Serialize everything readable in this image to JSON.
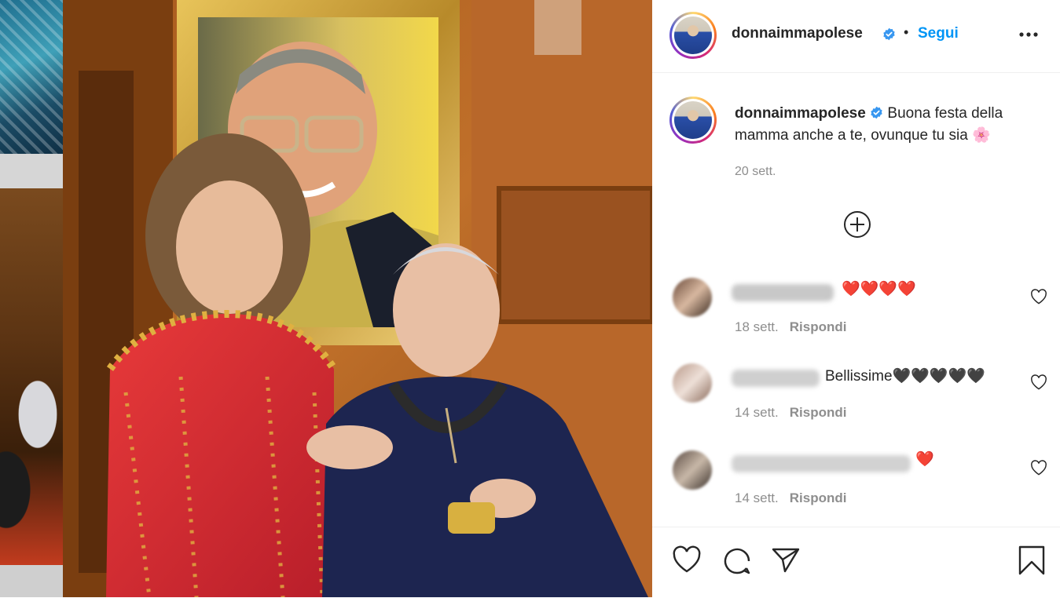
{
  "post": {
    "username": "donnaimmapolese",
    "follow_label": "Segui",
    "separator": "•",
    "caption_text": "Buona festa della mamma anche a te, ovunque tu sia",
    "caption_emoji": "🌸",
    "caption_time": "20 sett."
  },
  "comments": [
    {
      "text": "❤️❤️❤️❤️",
      "time": "18 sett.",
      "reply_label": "Rispondi"
    },
    {
      "text": "Bellissime🖤🖤🖤🖤🖤",
      "time": "14 sett.",
      "reply_label": "Rispondi"
    },
    {
      "text": "❤️",
      "time": "14 sett.",
      "reply_label": "Rispondi"
    }
  ],
  "icons": {
    "more": "more-options-icon",
    "verified": "verified-badge-icon",
    "load_more": "plus-circle-icon",
    "like": "heart-icon",
    "comment": "comment-icon",
    "share": "paper-plane-icon",
    "save": "bookmark-icon"
  },
  "colors": {
    "accent": "#0095f6",
    "text": "#262626",
    "muted": "#8e8e8e",
    "heart_red": "#ed4956"
  }
}
